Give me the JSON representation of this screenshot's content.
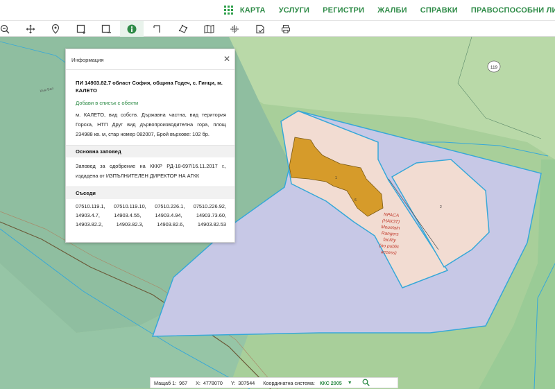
{
  "nav": {
    "items": [
      "КАРТА",
      "УСЛУГИ",
      "РЕГИСТРИ",
      "ЖАЛБИ",
      "СПРАВКИ",
      "ПРАВОСПОСОБНИ ЛИЦА"
    ]
  },
  "toolbar": {
    "tools": [
      "zoom-out-icon",
      "pan-icon",
      "location-pin-icon",
      "select-rect-icon",
      "select-rect-minus-icon",
      "info-icon",
      "measure-icon",
      "polygon-icon",
      "map-layers-icon",
      "crosshair-icon",
      "document-icon",
      "print-icon"
    ],
    "active_tool": "info-icon"
  },
  "map": {
    "parcel_labels": {
      "main": "1",
      "inner": "6",
      "second": "2"
    },
    "road_badge": "119",
    "road_name": "Към Бал",
    "facility_label": [
      "NPACA",
      "(НАКЗТ)",
      "Mountain",
      "Rangers",
      "facility",
      "(no public",
      "access)"
    ],
    "colors": {
      "forest_light": "#a8cf9a",
      "forest_mid": "#8bbd96",
      "water_teal": "#a4c8bc",
      "parcel_fill": "#c7c8e6",
      "parcel_pink": "#f2dcd2",
      "building_fill": "#d69b2a",
      "outline_blue": "#37a8d8",
      "facility_text": "#c0392b"
    }
  },
  "popup": {
    "title": "Информация",
    "heading": "ПИ 14903.82.7 област София, община Годеч, с. Гинци, м. КАЛЕТО",
    "add_link": "Добави в списък с обекти",
    "details": "м. КАЛЕТО, вид собств. Държавна частна, вид територия Горска, НТП Друг вид дървопроизводителна гора, площ 234988 кв. м, стар номер 082007, Брой върхове: 102 бр.",
    "order_heading": "Основна заповед",
    "order_text": "Заповед за одобрение на КККР РД-18-697/16.11.2017 г., издадена от ИЗПЪЛНИТЕЛЕН ДИРЕКТОР НА АГКК",
    "neighbours_heading": "Съседи",
    "neighbours": [
      [
        "07510.119.1,",
        "07510.119.10,",
        "07510.226.1,",
        "07510.226.92,"
      ],
      [
        "14903.4.7,",
        "14903.4.55,",
        "14903.4.94,",
        "14903.73.60,"
      ],
      [
        "14903.82.2,",
        "14903.82.3,",
        "14903.82.6,",
        "14903.82.53"
      ]
    ]
  },
  "status": {
    "scale_label": "Мащаб 1:",
    "scale_value": "967",
    "x_label": "X:",
    "x_value": "4778070",
    "y_label": "Y:",
    "y_value": "307544",
    "system_label": "Координатна система:",
    "system_value": "ККС 2005"
  }
}
